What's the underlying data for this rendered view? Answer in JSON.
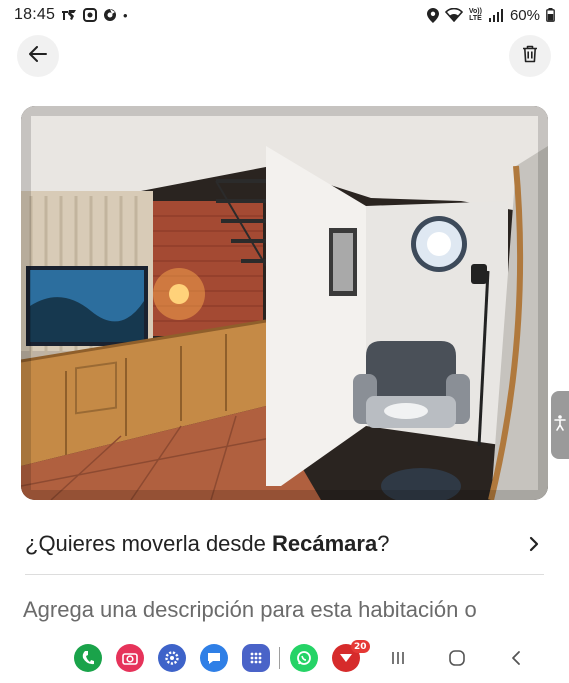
{
  "status_bar": {
    "time": "18:45",
    "dot": "•",
    "battery_pct": "60%",
    "left_icons": [
      "notification-icon",
      "circle-app-icon",
      "browser-icon"
    ],
    "right_icons": [
      "location-icon",
      "wifi-icon",
      "volte-lte-icon",
      "signal-icon",
      "battery-icon"
    ],
    "lte_label": "LTE"
  },
  "header": {
    "back_icon": "arrow-left-icon",
    "delete_icon": "trash-icon"
  },
  "photo": {
    "subject": "room-photo"
  },
  "move_row": {
    "prefix": "¿Quieres moverla desde ",
    "room": "Recámara",
    "suffix": "?"
  },
  "description": {
    "placeholder": "Agrega una descripción para esta habitación o"
  },
  "dock": {
    "apps": [
      {
        "name": "phone-app",
        "color": "#1aa34a"
      },
      {
        "name": "camera-app",
        "color": "#e6335a"
      },
      {
        "name": "settings-app",
        "color": "#3e63c9"
      },
      {
        "name": "messages-app",
        "color": "#2f7fe6"
      },
      {
        "name": "apps-drawer",
        "color": "#4a63c8"
      },
      {
        "name": "whatsapp-app",
        "color": "#25d366"
      },
      {
        "name": "bank-app",
        "color": "#d62b2b"
      }
    ],
    "badge_count": "20"
  },
  "accent_colors": {
    "text_primary": "#222222",
    "text_secondary": "#6b6b6b",
    "button_bg": "#f1f1f1"
  }
}
